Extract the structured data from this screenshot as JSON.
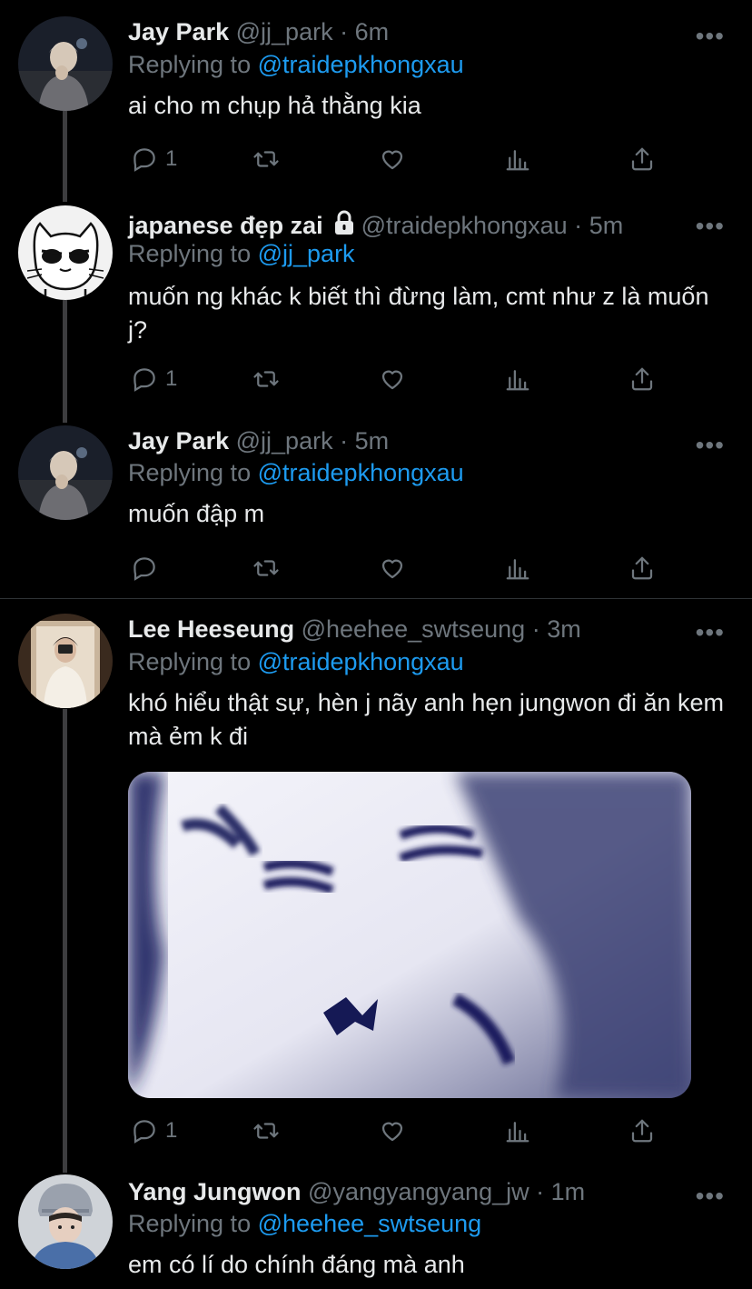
{
  "tweets": [
    {
      "name": "Jay Park",
      "handle": "@jj_park",
      "time": "6m",
      "replying_label": "Replying to",
      "replying_to": "@traidepkhongxau",
      "text": "ai cho m chụp hả thằng kia",
      "reply_count": "1",
      "avatar_icon": "jay-avatar"
    },
    {
      "name": "japanese đẹp zai",
      "handle": "@traidepkhongxau",
      "time": "5m",
      "replying_label": "Replying to",
      "replying_to": "@jj_park",
      "text": "muốn ng khác k biết thì đừng làm, cmt như z là muốn j?",
      "reply_count": "1",
      "avatar_icon": "cat-avatar",
      "locked": true
    },
    {
      "name": "Jay Park",
      "handle": "@jj_park",
      "time": "5m",
      "replying_label": "Replying to",
      "replying_to": "@traidepkhongxau",
      "text": "muốn đập m",
      "reply_count": "",
      "avatar_icon": "jay-avatar"
    },
    {
      "name": "Lee Heeseung",
      "handle": "@heehee_swtseung",
      "time": "3m",
      "replying_label": "Replying to",
      "replying_to": "@traidepkhongxau",
      "text": "khó hiểu thật sự, hèn j nãy anh hẹn jungwon đi ăn kem mà ẻm k đi",
      "reply_count": "1",
      "avatar_icon": "heeseung-avatar",
      "media": "blurry-meme-image"
    },
    {
      "name": "Yang Jungwon",
      "handle": "@yangyangyang_jw",
      "time": "1m",
      "replying_label": "Replying to",
      "replying_to": "@heehee_swtseung",
      "text": "em có lí do chính đáng mà anh",
      "avatar_icon": "jungwon-avatar"
    }
  ],
  "separator": "·",
  "more_glyph": "•••",
  "colors": {
    "background": "#000000",
    "text": "#e7e9ea",
    "secondary": "#6e767d",
    "link": "#1d9bf0"
  }
}
